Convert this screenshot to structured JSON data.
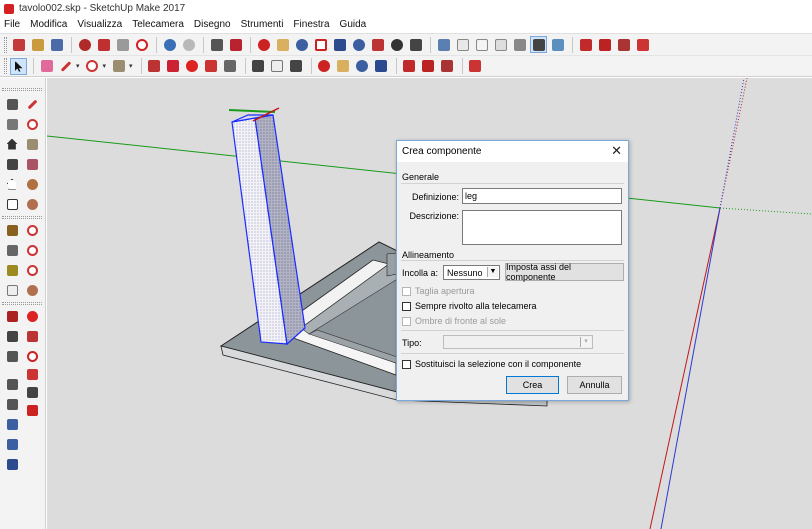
{
  "window": {
    "title": "tavolo002.skp - SketchUp Make 2017"
  },
  "menu": [
    "File",
    "Modifica",
    "Visualizza",
    "Telecamera",
    "Disegno",
    "Strumenti",
    "Finestra",
    "Guida"
  ],
  "colors": {
    "accent": "#0078d7",
    "dialog_border": "#7aa8d8",
    "axis_green": "#1a9a1a",
    "axis_red": "#c01818",
    "axis_blue": "#2a3bd0",
    "selection": "#1c2cff"
  },
  "dialog": {
    "title": "Crea componente",
    "section_general": "Generale",
    "definition_label": "Definizione:",
    "definition_value": "leg",
    "description_label": "Descrizione:",
    "description_value": "",
    "section_alignment": "Allineamento",
    "glue_label": "Incolla a:",
    "glue_value": "Nessuno",
    "set_axes_button": "Imposta assi del componente",
    "cut_opening": "Taglia apertura",
    "always_face_camera": "Sempre rivolto alla telecamera",
    "shadows_face_sun": "Ombre di fronte al sole",
    "type_label": "Tipo:",
    "type_value": "",
    "replace_selection": "Sostituisci la selezione con il componente",
    "create_button": "Crea",
    "cancel_button": "Annulla"
  }
}
